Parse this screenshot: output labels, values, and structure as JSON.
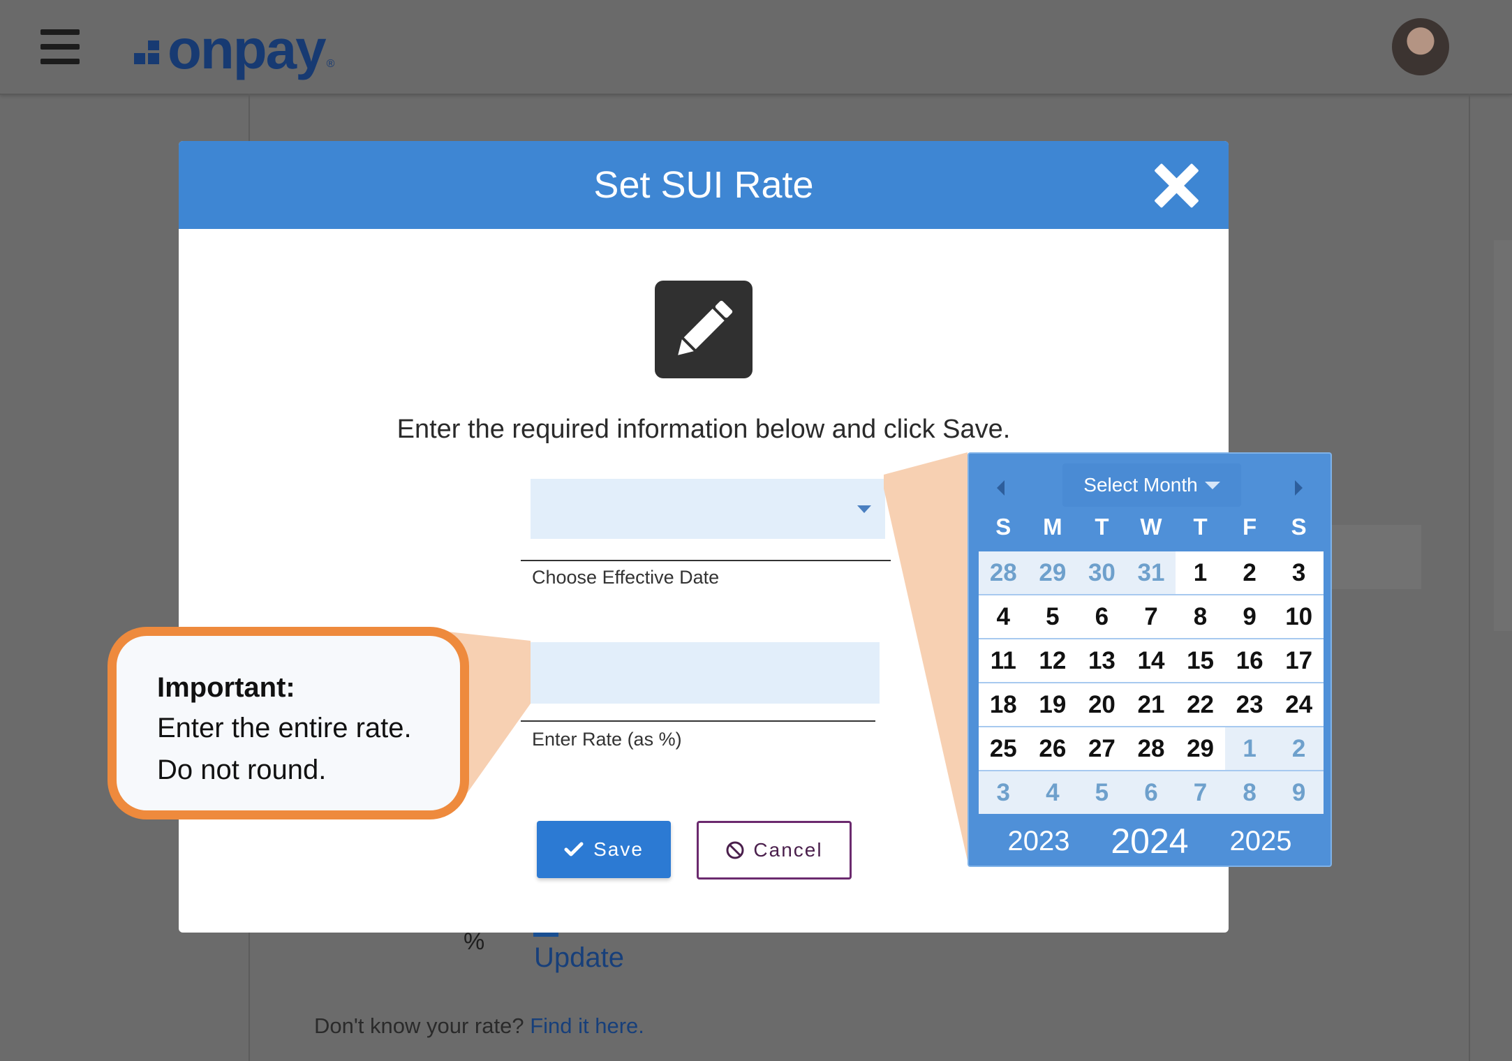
{
  "header": {
    "logo_text": "onpay",
    "logo_mark": "®"
  },
  "background": {
    "percent_sign": "%",
    "update_label": "Update",
    "help_text": "Don't know your rate?",
    "help_link": "Find it here."
  },
  "modal": {
    "title": "Set SUI Rate",
    "instruction": "Enter the required information below and click Save.",
    "date_field": {
      "label": "Choose Effective Date",
      "value": ""
    },
    "rate_field": {
      "label": "Enter Rate (as %)",
      "value": "",
      "placeholder": ""
    },
    "save_label": "Save",
    "cancel_label": "Cancel"
  },
  "callout": {
    "title": "Important:",
    "line1": "Enter the entire rate.",
    "line2": "Do not round."
  },
  "calendar": {
    "month_select_label": "Select Month",
    "weekdays": [
      "S",
      "M",
      "T",
      "W",
      "T",
      "F",
      "S"
    ],
    "weeks": [
      [
        {
          "d": "28",
          "o": true
        },
        {
          "d": "29",
          "o": true
        },
        {
          "d": "30",
          "o": true
        },
        {
          "d": "31",
          "o": true
        },
        {
          "d": "1",
          "o": false
        },
        {
          "d": "2",
          "o": false
        },
        {
          "d": "3",
          "o": false
        }
      ],
      [
        {
          "d": "4",
          "o": false
        },
        {
          "d": "5",
          "o": false
        },
        {
          "d": "6",
          "o": false
        },
        {
          "d": "7",
          "o": false
        },
        {
          "d": "8",
          "o": false
        },
        {
          "d": "9",
          "o": false
        },
        {
          "d": "10",
          "o": false
        }
      ],
      [
        {
          "d": "11",
          "o": false
        },
        {
          "d": "12",
          "o": false
        },
        {
          "d": "13",
          "o": false
        },
        {
          "d": "14",
          "o": false
        },
        {
          "d": "15",
          "o": false
        },
        {
          "d": "16",
          "o": false
        },
        {
          "d": "17",
          "o": false
        }
      ],
      [
        {
          "d": "18",
          "o": false
        },
        {
          "d": "19",
          "o": false
        },
        {
          "d": "20",
          "o": false
        },
        {
          "d": "21",
          "o": false
        },
        {
          "d": "22",
          "o": false
        },
        {
          "d": "23",
          "o": false
        },
        {
          "d": "24",
          "o": false
        }
      ],
      [
        {
          "d": "25",
          "o": false
        },
        {
          "d": "26",
          "o": false
        },
        {
          "d": "27",
          "o": false
        },
        {
          "d": "28",
          "o": false
        },
        {
          "d": "29",
          "o": false
        },
        {
          "d": "1",
          "o": true
        },
        {
          "d": "2",
          "o": true
        }
      ],
      [
        {
          "d": "3",
          "o": true
        },
        {
          "d": "4",
          "o": true
        },
        {
          "d": "5",
          "o": true
        },
        {
          "d": "6",
          "o": true
        },
        {
          "d": "7",
          "o": true
        },
        {
          "d": "8",
          "o": true
        },
        {
          "d": "9",
          "o": true
        }
      ]
    ],
    "years": {
      "prev": "2023",
      "current": "2024",
      "next": "2025"
    }
  },
  "colors": {
    "header_blue": "#3e86d3",
    "save_blue": "#2c7ad3",
    "cancel_purple": "#6b2a6e",
    "callout_orange": "#ee8a3d",
    "brand_navy": "#173a72"
  }
}
